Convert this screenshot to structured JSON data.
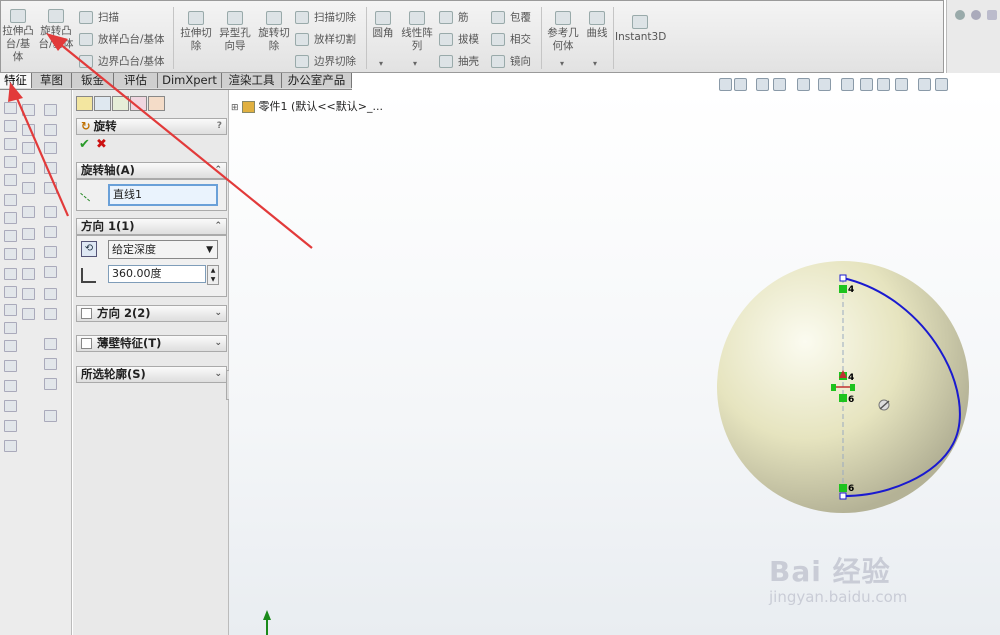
{
  "ribbon": {
    "extrude_boss": "拉伸凸台/基体",
    "revolve_boss": "旋转凸台/基体",
    "sweep": "扫描",
    "loft_boss": "放样凸台/基体",
    "boundary_boss": "边界凸台/基体",
    "extrude_cut": "拉伸切除",
    "hole_wizard": "异型孔向导",
    "revolve_cut": "旋转切除",
    "swept_cut": "扫描切除",
    "lofted_cut": "放样切割",
    "boundary_cut": "边界切除",
    "fillet": "圆角",
    "linear_pattern": "线性阵列",
    "rib": "筋",
    "draft": "拔模",
    "shell": "抽壳",
    "wrap": "包覆",
    "intersect": "相交",
    "mirror": "镜向",
    "reference_geometry": "参考几何体",
    "curves": "曲线",
    "instant3d": "Instant3D"
  },
  "tabs": [
    "特征",
    "草图",
    "钣金",
    "评估",
    "DimXpert",
    "渲染工具",
    "办公室产品"
  ],
  "tree": {
    "part": "零件1",
    "config": "(默认<<默认>_..."
  },
  "pm": {
    "title": "旋转",
    "help": "?",
    "axis_label": "旋转轴(A)",
    "axis_value": "直线1",
    "dir1_label": "方向 1(1)",
    "end_condition": "给定深度",
    "angle": "360.00度",
    "dir2_label": "方向 2(2)",
    "thin_label": "薄壁特征(T)",
    "contours_label": "所选轮廓(S)"
  },
  "sketch_marks": {
    "top": "4",
    "mid_upper": "4",
    "mid_lower": "6",
    "bottom": "6"
  },
  "colors": {
    "sketch_curve": "#1a1ad0",
    "sketch_point": "#1ec31e",
    "sphere": "#e8e6c4"
  },
  "watermark": {
    "brand": "Bai 经验",
    "url": "jingyan.baidu.com"
  }
}
